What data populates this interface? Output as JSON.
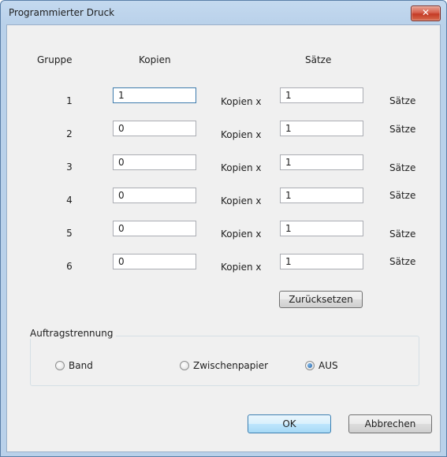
{
  "window": {
    "title": "Programmierter Druck",
    "close_label": "✕"
  },
  "headers": {
    "group": "Gruppe",
    "copies": "Kopien",
    "sets": "Sätze"
  },
  "rows": [
    {
      "group": "1",
      "copies": "1",
      "multiplier_label": "Kopien x",
      "sets": "1",
      "sets_label": "Sätze"
    },
    {
      "group": "2",
      "copies": "0",
      "multiplier_label": "Kopien x",
      "sets": "1",
      "sets_label": "Sätze"
    },
    {
      "group": "3",
      "copies": "0",
      "multiplier_label": "Kopien x",
      "sets": "1",
      "sets_label": "Sätze"
    },
    {
      "group": "4",
      "copies": "0",
      "multiplier_label": "Kopien x",
      "sets": "1",
      "sets_label": "Sätze"
    },
    {
      "group": "5",
      "copies": "0",
      "multiplier_label": "Kopien x",
      "sets": "1",
      "sets_label": "Sätze"
    },
    {
      "group": "6",
      "copies": "0",
      "multiplier_label": "Kopien x",
      "sets": "1",
      "sets_label": "Sätze"
    }
  ],
  "reset_label": "Zurücksetzen",
  "separation": {
    "title": "Auftragstrennung",
    "options": [
      {
        "label": "Band",
        "checked": false
      },
      {
        "label": "Zwischenpapier",
        "checked": false
      },
      {
        "label": "AUS",
        "checked": true
      }
    ]
  },
  "buttons": {
    "ok": "OK",
    "cancel": "Abbrechen"
  }
}
